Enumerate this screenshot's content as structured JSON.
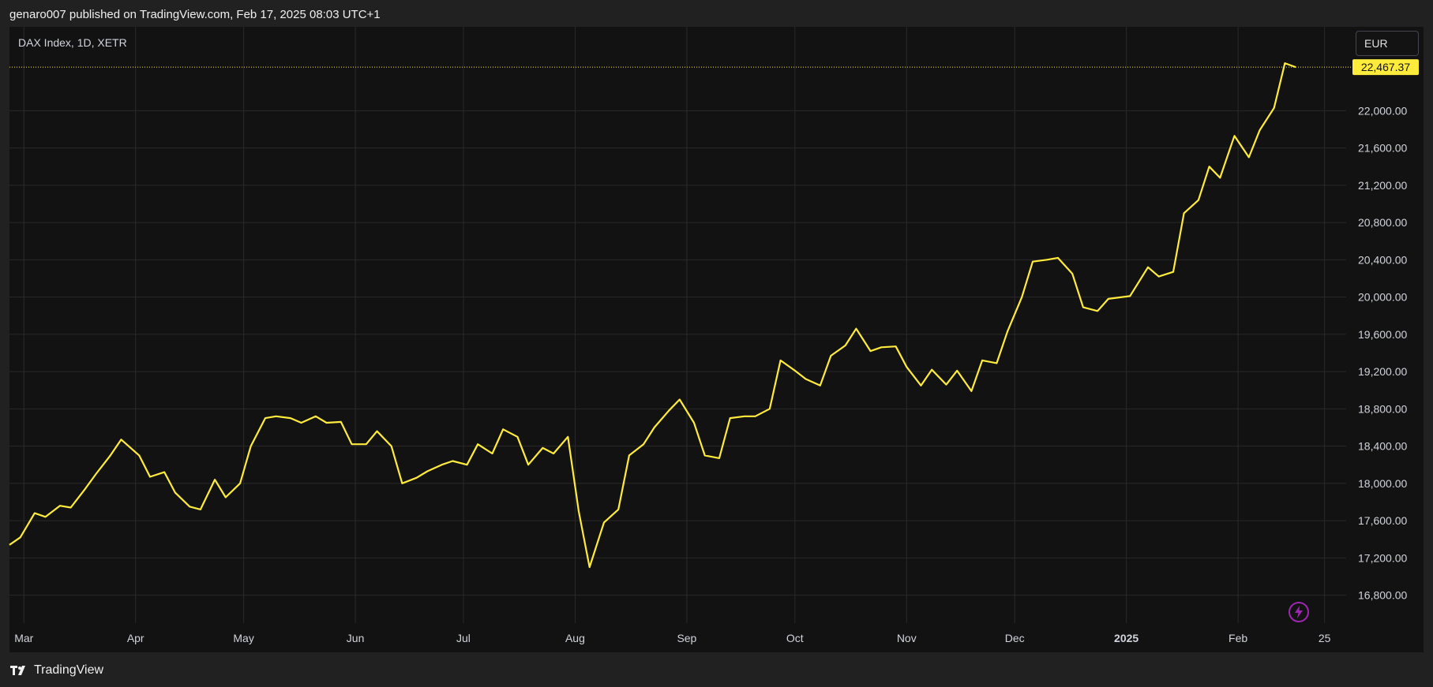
{
  "header": {
    "published_text": "genaro007 published on TradingView.com, Feb 17, 2025 08:03 UTC+1"
  },
  "legend": {
    "symbol_text": "DAX Index, 1D, XETR"
  },
  "currency_selector": {
    "label": "EUR"
  },
  "footer": {
    "brand": "TradingView"
  },
  "colors": {
    "background": "#212121",
    "plot_background": "#121212",
    "line": "#FFEB3B",
    "grid": "#2a2a2a",
    "text": "#d1d4dc",
    "price_tag_bg": "#FFEB3B",
    "price_tag_text": "#131313",
    "lightning_icon": "#9C27B0"
  },
  "icons": {
    "logo": "tradingview-logo-icon",
    "lightning": "lightning-icon"
  },
  "chart_data": {
    "type": "line",
    "title": "DAX Index, 1D, XETR",
    "currency": "EUR",
    "grid": true,
    "y_axis_position": "right",
    "ylim": [
      16500,
      22900
    ],
    "xlim": [
      "2024-02-26",
      "2025-03-03"
    ],
    "y_ticks": [
      16800,
      17200,
      17600,
      18000,
      18400,
      18800,
      19200,
      19600,
      20000,
      20400,
      20800,
      21200,
      21600,
      22000
    ],
    "y_tick_labels": [
      "16,800.00",
      "17,200.00",
      "17,600.00",
      "18,000.00",
      "18,400.00",
      "18,800.00",
      "19,200.00",
      "19,600.00",
      "20,000.00",
      "20,400.00",
      "20,800.00",
      "21,200.00",
      "21,600.00",
      "22,000.00"
    ],
    "x_ticks": [
      {
        "date": "2024-03-01",
        "label": "Mar",
        "bold": false
      },
      {
        "date": "2024-04-01",
        "label": "Apr",
        "bold": false
      },
      {
        "date": "2024-05-01",
        "label": "May",
        "bold": false
      },
      {
        "date": "2024-06-01",
        "label": "Jun",
        "bold": false
      },
      {
        "date": "2024-07-01",
        "label": "Jul",
        "bold": false
      },
      {
        "date": "2024-08-01",
        "label": "Aug",
        "bold": false
      },
      {
        "date": "2024-09-01",
        "label": "Sep",
        "bold": false
      },
      {
        "date": "2024-10-01",
        "label": "Oct",
        "bold": false
      },
      {
        "date": "2024-11-01",
        "label": "Nov",
        "bold": false
      },
      {
        "date": "2024-12-01",
        "label": "Dec",
        "bold": false
      },
      {
        "date": "2025-01-01",
        "label": "2025",
        "bold": true
      },
      {
        "date": "2025-02-01",
        "label": "Feb",
        "bold": false
      },
      {
        "date": "2025-02-25",
        "label": "25",
        "bold": false
      }
    ],
    "last_price": 22467.37,
    "last_price_label": "22,467.37",
    "series": [
      {
        "points": [
          [
            "2024-02-26",
            17340
          ],
          [
            "2024-02-29",
            17420
          ],
          [
            "2024-03-04",
            17680
          ],
          [
            "2024-03-07",
            17640
          ],
          [
            "2024-03-11",
            17760
          ],
          [
            "2024-03-14",
            17740
          ],
          [
            "2024-03-18",
            17940
          ],
          [
            "2024-03-21",
            18100
          ],
          [
            "2024-03-25",
            18300
          ],
          [
            "2024-03-28",
            18470
          ],
          [
            "2024-04-02",
            18300
          ],
          [
            "2024-04-05",
            18070
          ],
          [
            "2024-04-09",
            18120
          ],
          [
            "2024-04-12",
            17900
          ],
          [
            "2024-04-16",
            17750
          ],
          [
            "2024-04-19",
            17720
          ],
          [
            "2024-04-23",
            18040
          ],
          [
            "2024-04-26",
            17850
          ],
          [
            "2024-04-30",
            18000
          ],
          [
            "2024-05-03",
            18400
          ],
          [
            "2024-05-07",
            18700
          ],
          [
            "2024-05-10",
            18720
          ],
          [
            "2024-05-14",
            18700
          ],
          [
            "2024-05-17",
            18650
          ],
          [
            "2024-05-21",
            18720
          ],
          [
            "2024-05-24",
            18650
          ],
          [
            "2024-05-28",
            18660
          ],
          [
            "2024-05-31",
            18420
          ],
          [
            "2024-06-04",
            18420
          ],
          [
            "2024-06-07",
            18560
          ],
          [
            "2024-06-11",
            18400
          ],
          [
            "2024-06-14",
            18000
          ],
          [
            "2024-06-18",
            18060
          ],
          [
            "2024-06-21",
            18130
          ],
          [
            "2024-06-25",
            18200
          ],
          [
            "2024-06-28",
            18240
          ],
          [
            "2024-07-02",
            18200
          ],
          [
            "2024-07-05",
            18420
          ],
          [
            "2024-07-09",
            18320
          ],
          [
            "2024-07-12",
            18580
          ],
          [
            "2024-07-16",
            18500
          ],
          [
            "2024-07-19",
            18200
          ],
          [
            "2024-07-23",
            18380
          ],
          [
            "2024-07-26",
            18320
          ],
          [
            "2024-07-30",
            18500
          ],
          [
            "2024-08-02",
            17700
          ],
          [
            "2024-08-05",
            17100
          ],
          [
            "2024-08-09",
            17580
          ],
          [
            "2024-08-13",
            17720
          ],
          [
            "2024-08-16",
            18300
          ],
          [
            "2024-08-20",
            18420
          ],
          [
            "2024-08-23",
            18600
          ],
          [
            "2024-08-27",
            18780
          ],
          [
            "2024-08-30",
            18900
          ],
          [
            "2024-09-03",
            18650
          ],
          [
            "2024-09-06",
            18300
          ],
          [
            "2024-09-10",
            18270
          ],
          [
            "2024-09-13",
            18700
          ],
          [
            "2024-09-17",
            18720
          ],
          [
            "2024-09-20",
            18720
          ],
          [
            "2024-09-24",
            18800
          ],
          [
            "2024-09-27",
            19320
          ],
          [
            "2024-10-01",
            19210
          ],
          [
            "2024-10-04",
            19120
          ],
          [
            "2024-10-08",
            19050
          ],
          [
            "2024-10-11",
            19370
          ],
          [
            "2024-10-15",
            19480
          ],
          [
            "2024-10-18",
            19660
          ],
          [
            "2024-10-22",
            19420
          ],
          [
            "2024-10-25",
            19460
          ],
          [
            "2024-10-29",
            19470
          ],
          [
            "2024-11-01",
            19250
          ],
          [
            "2024-11-05",
            19050
          ],
          [
            "2024-11-08",
            19220
          ],
          [
            "2024-11-12",
            19060
          ],
          [
            "2024-11-15",
            19210
          ],
          [
            "2024-11-19",
            18990
          ],
          [
            "2024-11-22",
            19320
          ],
          [
            "2024-11-26",
            19290
          ],
          [
            "2024-11-29",
            19630
          ],
          [
            "2024-12-03",
            20000
          ],
          [
            "2024-12-06",
            20380
          ],
          [
            "2024-12-10",
            20400
          ],
          [
            "2024-12-13",
            20420
          ],
          [
            "2024-12-17",
            20250
          ],
          [
            "2024-12-20",
            19890
          ],
          [
            "2024-12-24",
            19850
          ],
          [
            "2024-12-27",
            19980
          ],
          [
            "2025-01-02",
            20010
          ],
          [
            "2025-01-07",
            20320
          ],
          [
            "2025-01-10",
            20220
          ],
          [
            "2025-01-14",
            20270
          ],
          [
            "2025-01-17",
            20900
          ],
          [
            "2025-01-21",
            21040
          ],
          [
            "2025-01-24",
            21400
          ],
          [
            "2025-01-27",
            21280
          ],
          [
            "2025-01-31",
            21730
          ],
          [
            "2025-02-04",
            21500
          ],
          [
            "2025-02-07",
            21790
          ],
          [
            "2025-02-11",
            22030
          ],
          [
            "2025-02-14",
            22510
          ],
          [
            "2025-02-17",
            22467.37
          ]
        ]
      }
    ]
  }
}
